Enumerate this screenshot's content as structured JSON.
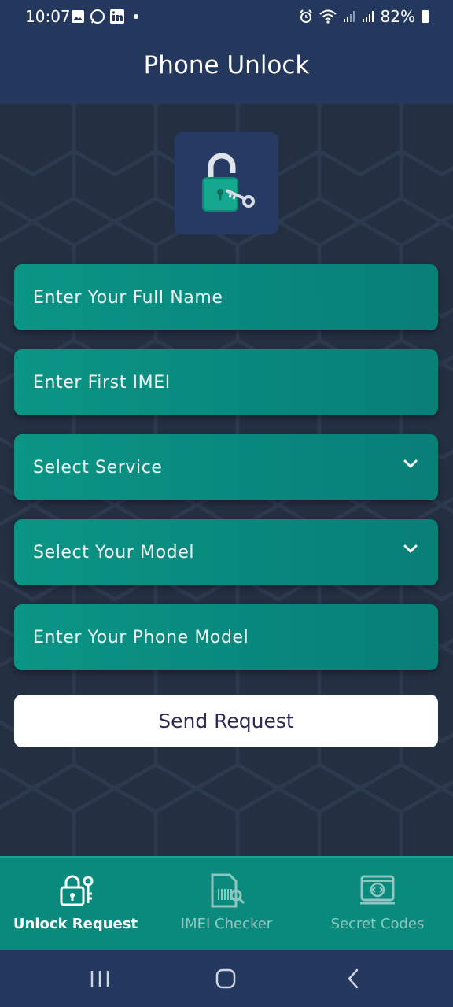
{
  "status_bar": {
    "time": "10:07",
    "battery": "82%",
    "notification_icons": [
      "gallery-icon",
      "whatsapp-icon",
      "linkedin-icon"
    ],
    "system_icons": [
      "alarm-icon",
      "wifi-icon",
      "signal-icon",
      "signal-icon",
      "battery-icon"
    ]
  },
  "app_bar": {
    "title": "Phone Unlock"
  },
  "logo": {
    "icon": "padlock-with-key-icon"
  },
  "form": {
    "full_name_placeholder": "Enter Your Full Name",
    "imei_placeholder": "Enter First IMEI",
    "service_placeholder": "Select Service",
    "model_placeholder": "Select Your Model",
    "phone_model_placeholder": "Enter Your Phone Model",
    "send_button": "Send Request"
  },
  "bottom_nav": {
    "tabs": [
      {
        "label": "Unlock Request",
        "icon": "unlock-request-icon",
        "active": true
      },
      {
        "label": "IMEI Checker",
        "icon": "imei-checker-icon",
        "active": false
      },
      {
        "label": "Secret Codes",
        "icon": "secret-codes-icon",
        "active": false
      }
    ]
  },
  "system_nav": {
    "icons": [
      "recents-icon",
      "home-icon",
      "back-icon"
    ]
  },
  "colors": {
    "header": "#24385e",
    "background": "#242f42",
    "field": "#0a9585",
    "nav": "#0a8a7c",
    "button_text": "#2f2a55"
  }
}
